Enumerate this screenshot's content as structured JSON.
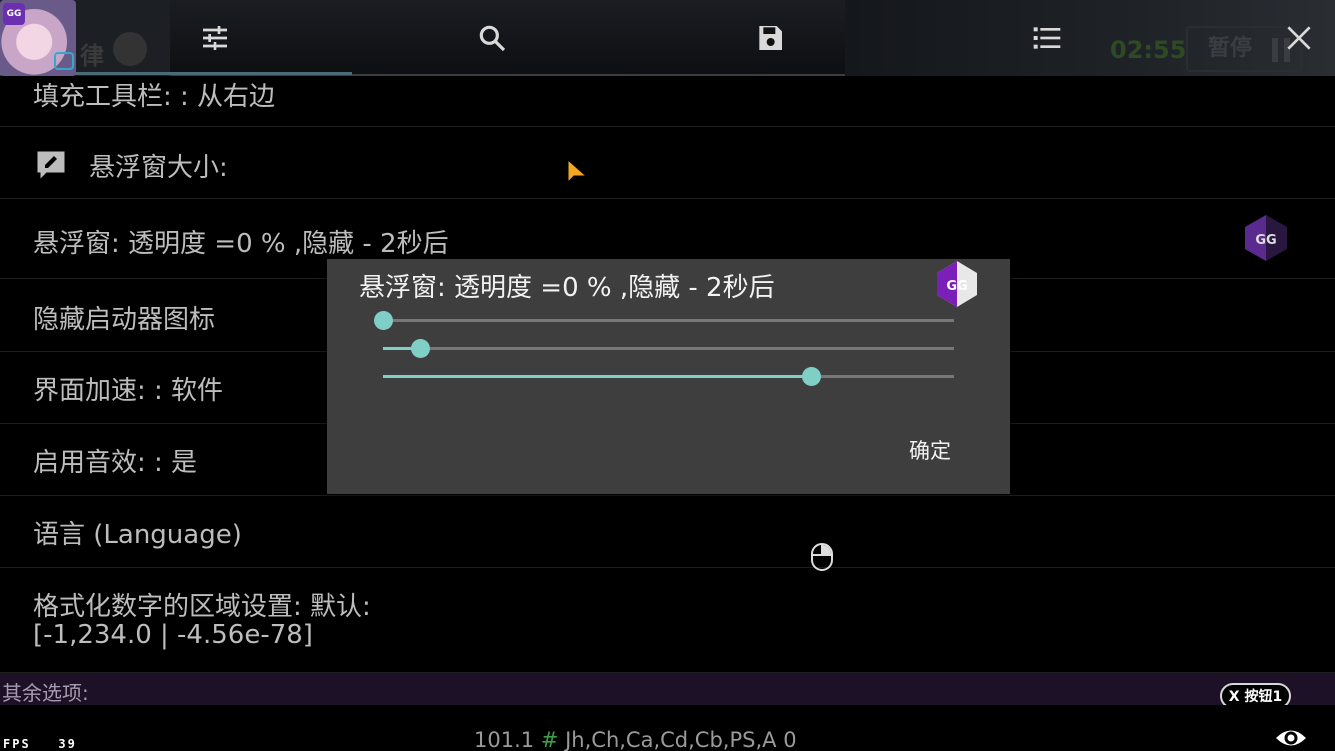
{
  "toolbar": {
    "icons": [
      "sliders-icon",
      "search-icon",
      "save-icon",
      "list-icon",
      "close-icon"
    ],
    "game_overlay": {
      "left_text": "律",
      "timer": "02:55",
      "pause_label": "暂停"
    },
    "avatar_badge": "GG"
  },
  "settings": {
    "rows": [
      {
        "label": "填充工具栏: : 从右边"
      },
      {
        "label": "悬浮窗大小:"
      },
      {
        "label": "悬浮窗: 透明度 =0 % ,隐藏 - 2秒后"
      },
      {
        "label": "隐藏启动器图标"
      },
      {
        "label": "界面加速: : 软件"
      },
      {
        "label": "启用音效: : 是"
      },
      {
        "label": "语言 (Language)"
      },
      {
        "label": "格式化数字的区域设置: 默认:",
        "sublabel": "[-1,234.0 | -4.56e-78]"
      }
    ],
    "section_header": "其余选项:",
    "x_button": "X 按钮1"
  },
  "dialog": {
    "title": "悬浮窗: 透明度 =0 % ,隐藏 - 2秒后",
    "sliders": [
      {
        "name": "slider-1",
        "fraction": 0.0
      },
      {
        "name": "slider-2",
        "fraction": 0.065
      },
      {
        "name": "slider-3",
        "fraction": 0.75
      }
    ],
    "ok_label": "确定"
  },
  "status": {
    "value": "101.1",
    "hash": "#",
    "regions": "Jh,Ch,Ca,Cd,Cb,PS,A",
    "count": "0",
    "fps": "FPS   39"
  },
  "colors": {
    "accent": "#7fcfc6",
    "dialog_bg": "#3e3e3e",
    "gg_purple": "#6b2fb0",
    "section_bg": "#1c1126"
  }
}
